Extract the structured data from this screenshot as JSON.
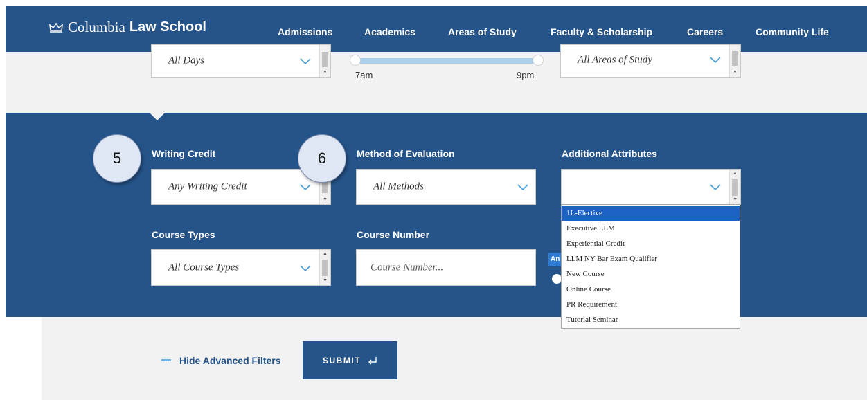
{
  "header": {
    "logo_word1": "Columbia",
    "logo_word2": "Law School",
    "nav": [
      "Admissions",
      "Academics",
      "Areas of Study",
      "Faculty & Scholarship",
      "Careers",
      "Community Life"
    ]
  },
  "top_filters": {
    "days_value": "All Days",
    "time_min_label": "7am",
    "time_max_label": "9pm",
    "areas_value": "All Areas of Study"
  },
  "advanced": {
    "writing_credit": {
      "label": "Writing Credit",
      "value": "Any Writing Credit"
    },
    "method_of_evaluation": {
      "label": "Method of Evaluation",
      "value": "All Methods"
    },
    "additional_attributes": {
      "label": "Additional Attributes",
      "value": "",
      "options": [
        "1L-Elective",
        "Executive LLM",
        "Experiential Credit",
        "LLM NY Bar Exam Qualifier",
        "New Course",
        "Online Course",
        "PR Requirement",
        "Tutorial Seminar"
      ],
      "highlighted": "1L-Elective"
    },
    "course_types": {
      "label": "Course Types",
      "value": "All Course Types"
    },
    "course_number": {
      "label": "Course Number",
      "placeholder": "Course Number..."
    },
    "partial_badge": "An"
  },
  "callouts": [
    "5",
    "6"
  ],
  "actions": {
    "hide_filters": "Hide Advanced Filters",
    "submit": "SUBMIT"
  },
  "colors": {
    "brand_blue": "#25548a",
    "accent_light_blue": "#6fb1e0",
    "highlight": "#1e62c4"
  }
}
